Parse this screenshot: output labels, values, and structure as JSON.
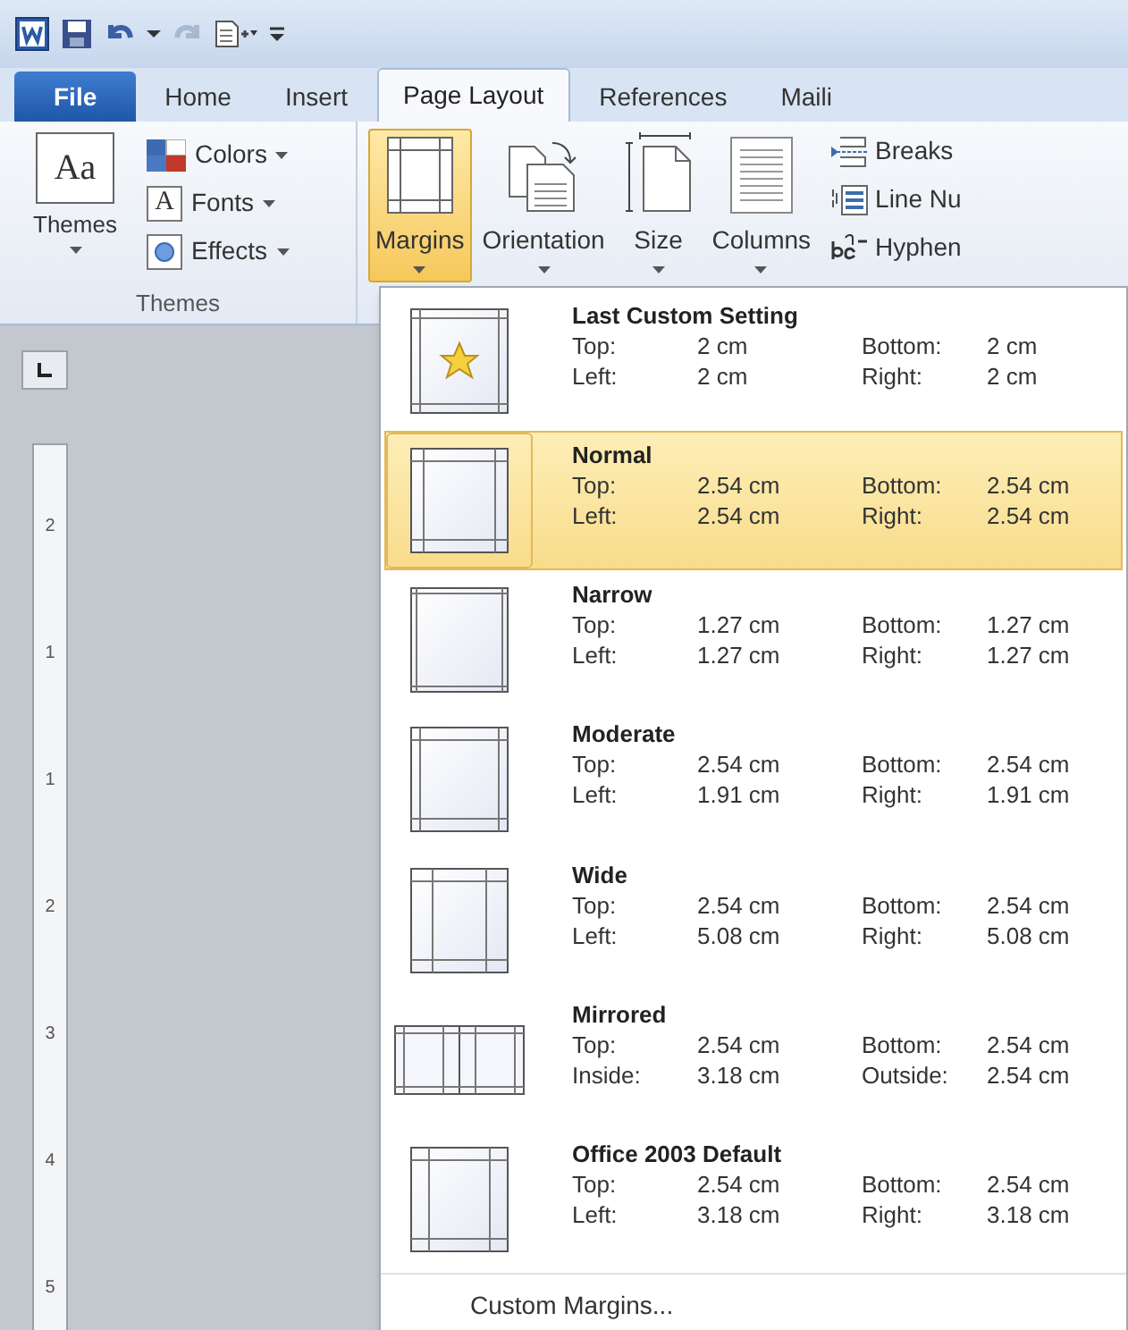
{
  "quick_access": [
    {
      "kind": "app"
    },
    {
      "kind": "save"
    },
    {
      "kind": "undo",
      "disabled": false
    },
    {
      "kind": "dropdown"
    },
    {
      "kind": "redo",
      "disabled": true
    },
    {
      "kind": "new"
    },
    {
      "kind": "customize"
    }
  ],
  "tabs": [
    {
      "label": "File",
      "kind": "file",
      "selected": false
    },
    {
      "label": "Home",
      "kind": "tab",
      "selected": false
    },
    {
      "label": "Insert",
      "kind": "tab",
      "selected": false
    },
    {
      "label": "Page Layout",
      "kind": "tab",
      "selected": true
    },
    {
      "label": "References",
      "kind": "tab",
      "selected": false
    },
    {
      "label": "Maili",
      "kind": "tab",
      "selected": false
    }
  ],
  "themes_group": {
    "themes_button": "Themes",
    "themes_icon_text": "Aa",
    "items": [
      {
        "label": "Colors",
        "kind": "colors"
      },
      {
        "label": "Fonts",
        "kind": "fonts",
        "icon_text": "A"
      },
      {
        "label": "Effects",
        "kind": "effects"
      }
    ],
    "group_label": "Themes"
  },
  "page_setup": {
    "buttons": [
      {
        "label": "Margins",
        "kind": "margins",
        "selected": true
      },
      {
        "label": "Orientation",
        "kind": "orientation",
        "selected": false
      },
      {
        "label": "Size",
        "kind": "size",
        "selected": false
      },
      {
        "label": "Columns",
        "kind": "columns",
        "selected": false
      }
    ],
    "small_buttons": [
      {
        "label": "Breaks",
        "kind": "breaks"
      },
      {
        "label": "Line Nu",
        "kind": "line-numbers"
      },
      {
        "label": "Hyphen",
        "kind": "hyphenation"
      }
    ]
  },
  "ruler": {
    "numbers": [
      "2",
      "1",
      "1",
      "2",
      "3",
      "4",
      "5"
    ]
  },
  "margins_menu": {
    "items": [
      {
        "name": "Last Custom Setting",
        "kind": "custom",
        "selected": false,
        "rows": [
          [
            "Top:",
            "2 cm",
            "Bottom:",
            "2 cm"
          ],
          [
            "Left:",
            "2 cm",
            "Right:",
            "2 cm"
          ]
        ]
      },
      {
        "name": "Normal",
        "kind": "normal",
        "selected": true,
        "rows": [
          [
            "Top:",
            "2.54 cm",
            "Bottom:",
            "2.54 cm"
          ],
          [
            "Left:",
            "2.54 cm",
            "Right:",
            "2.54 cm"
          ]
        ]
      },
      {
        "name": "Narrow",
        "kind": "narrow",
        "selected": false,
        "rows": [
          [
            "Top:",
            "1.27 cm",
            "Bottom:",
            "1.27 cm"
          ],
          [
            "Left:",
            "1.27 cm",
            "Right:",
            "1.27 cm"
          ]
        ]
      },
      {
        "name": "Moderate",
        "kind": "moderate",
        "selected": false,
        "rows": [
          [
            "Top:",
            "2.54 cm",
            "Bottom:",
            "2.54 cm"
          ],
          [
            "Left:",
            "1.91 cm",
            "Right:",
            "1.91 cm"
          ]
        ]
      },
      {
        "name": "Wide",
        "kind": "wide",
        "selected": false,
        "rows": [
          [
            "Top:",
            "2.54 cm",
            "Bottom:",
            "2.54 cm"
          ],
          [
            "Left:",
            "5.08 cm",
            "Right:",
            "5.08 cm"
          ]
        ]
      },
      {
        "name": "Mirrored",
        "kind": "mirrored",
        "selected": false,
        "rows": [
          [
            "Top:",
            "2.54 cm",
            "Bottom:",
            "2.54 cm"
          ],
          [
            "Inside:",
            "3.18 cm",
            "Outside:",
            "2.54 cm"
          ]
        ]
      },
      {
        "name": "Office 2003 Default",
        "kind": "office2003",
        "selected": false,
        "rows": [
          [
            "Top:",
            "2.54 cm",
            "Bottom:",
            "2.54 cm"
          ],
          [
            "Left:",
            "3.18 cm",
            "Right:",
            "3.18 cm"
          ]
        ]
      }
    ],
    "footer": "Custom Margins..."
  }
}
